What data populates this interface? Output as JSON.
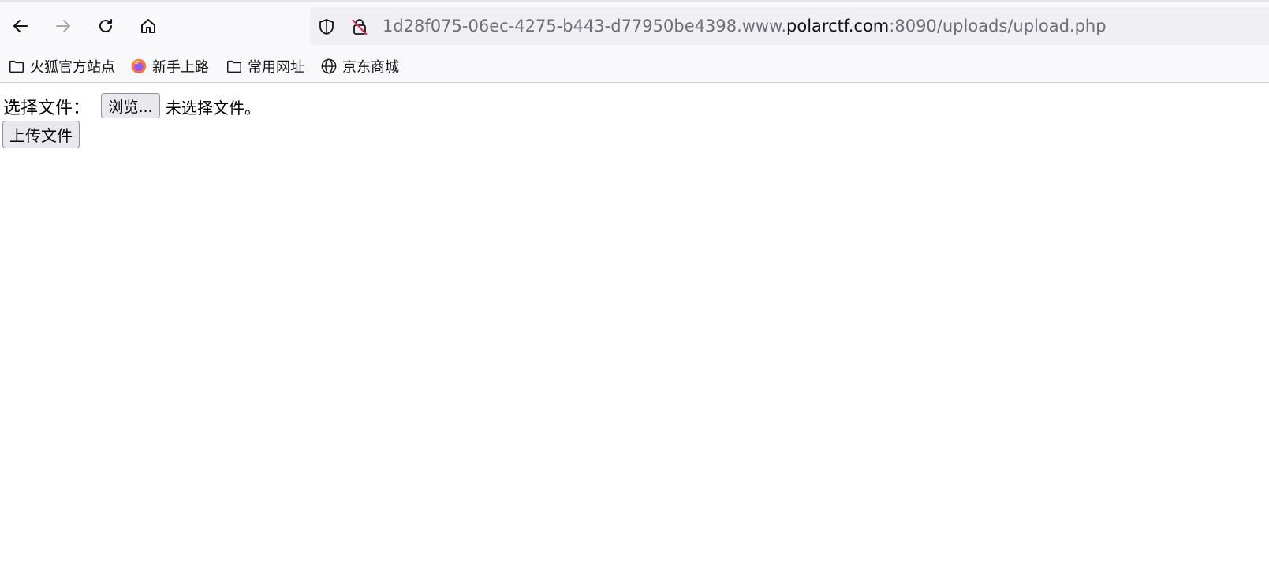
{
  "browser": {
    "url": {
      "prefix": "1d28f075-06ec-4275-b443-d77950be4398.www.",
      "highlight": "polarctf.com",
      "suffix": ":8090/uploads/upload.php"
    },
    "nav_icons": [
      "back-arrow-icon",
      "forward-arrow-icon",
      "reload-icon",
      "home-icon"
    ],
    "bookmarks": [
      {
        "label": "火狐官方站点",
        "icon": "folder-icon"
      },
      {
        "label": "新手上路",
        "icon": "firefox-icon"
      },
      {
        "label": "常用网址",
        "icon": "folder-icon"
      },
      {
        "label": "京东商城",
        "icon": "globe-icon"
      }
    ]
  },
  "page": {
    "file_label": "选择文件：",
    "browse_button": "浏览...",
    "no_file_text": "未选择文件。",
    "upload_button": "上传文件"
  },
  "colors": {
    "chrome_bg": "#f9f9fb",
    "urlbar_bg": "#f0f0f4",
    "button_bg": "#e9e9ed",
    "lock_slash": "#e22850"
  }
}
